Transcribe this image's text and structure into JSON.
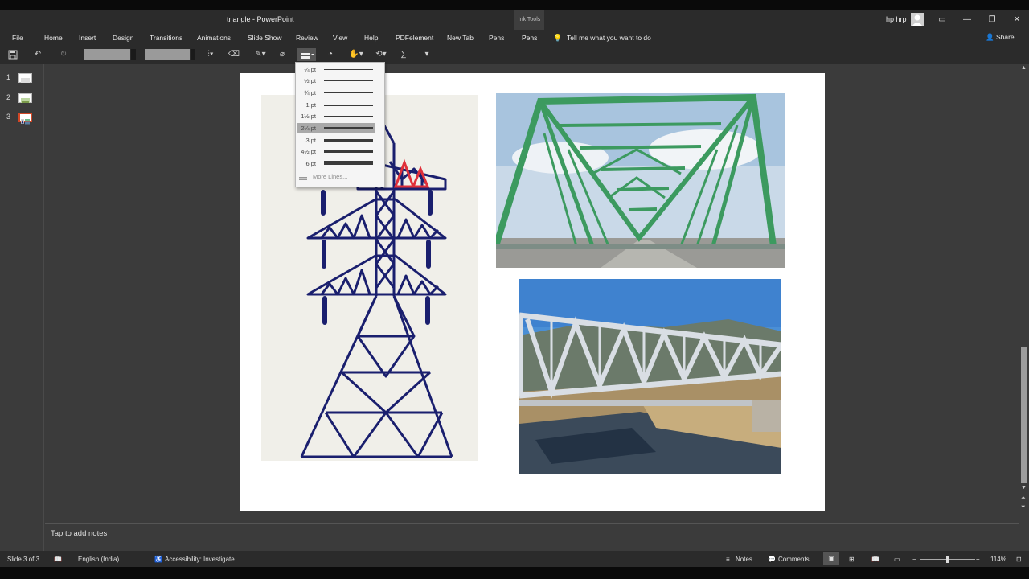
{
  "window": {
    "title": "triangle  -  PowerPoint",
    "context_tab": "Ink Tools",
    "user": "hp hrp"
  },
  "menu": {
    "items": [
      "File",
      "Home",
      "Insert",
      "Design",
      "Transitions",
      "Animations",
      "Slide Show",
      "Review",
      "View",
      "Help",
      "PDFelement",
      "New Tab",
      "Pens",
      "Pens"
    ],
    "tell_me": "Tell me what you want to do",
    "share": "Share"
  },
  "thumbnails": [
    {
      "number": "1"
    },
    {
      "number": "2"
    },
    {
      "number": "3",
      "selected": true
    }
  ],
  "line_weight_menu": {
    "items": [
      "¼ pt",
      "½ pt",
      "¾ pt",
      "1 pt",
      "1½ pt",
      "2¼ pt",
      "3 pt",
      "4½ pt",
      "6 pt"
    ],
    "selected": "2¼ pt",
    "more": "More Lines..."
  },
  "notes": {
    "placeholder": "Tap to add notes"
  },
  "status": {
    "slide": "Slide 3 of 3",
    "language": "English (India)",
    "accessibility": "Accessibility: Investigate",
    "notes_btn": "Notes",
    "comments_btn": "Comments",
    "zoom": "114%"
  },
  "colors": {
    "accent_red": "#d24726",
    "tower_blue": "#1a1f6e",
    "bridge_green": "#3c9a5f",
    "sky": "#4a8fd6"
  }
}
